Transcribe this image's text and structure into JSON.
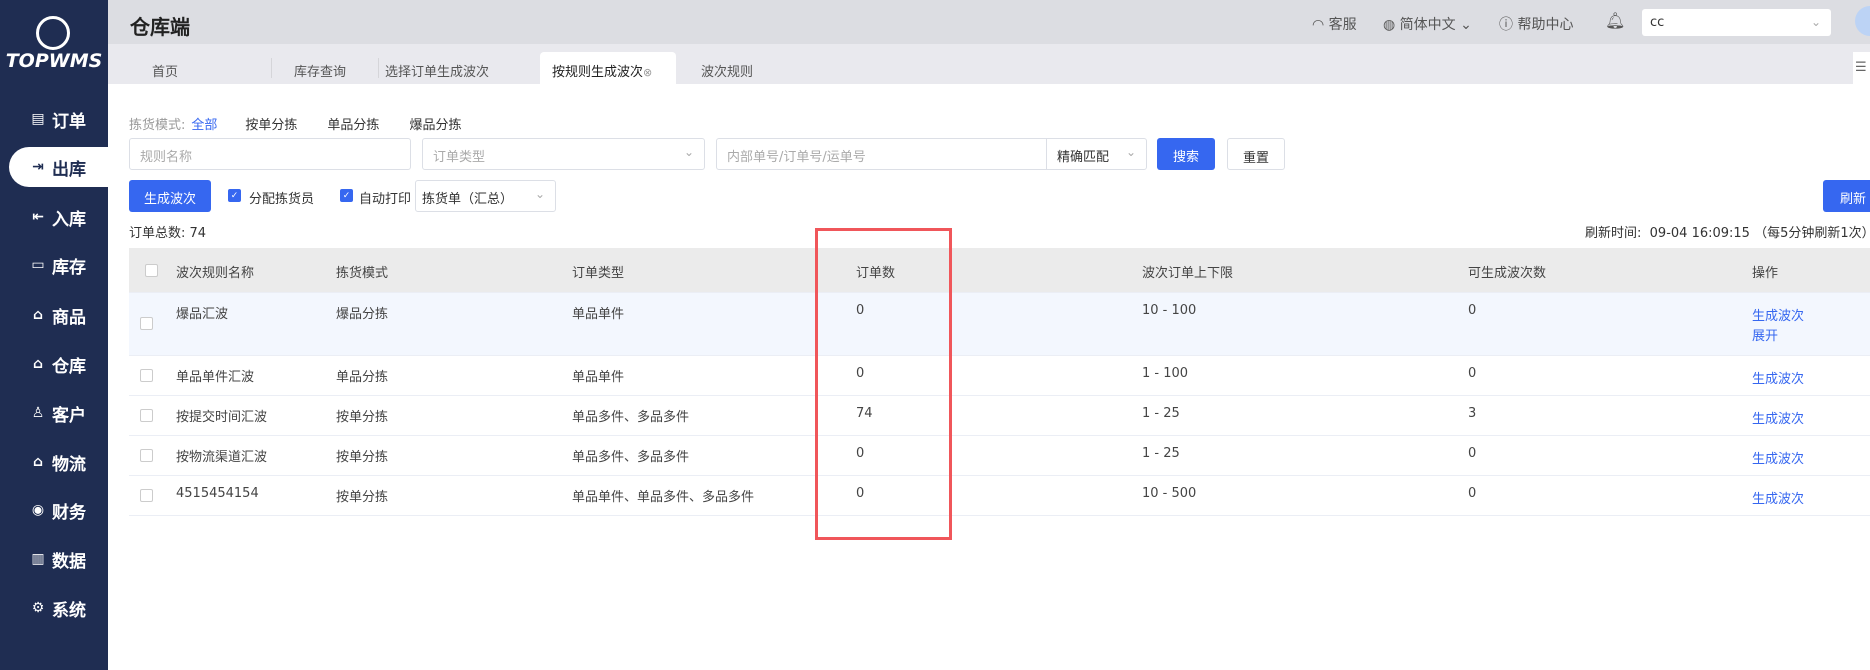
{
  "brand": {
    "name": "TOPWMS"
  },
  "sidebar": {
    "items": [
      {
        "label": "订单",
        "icon": "order-icon",
        "glyph": "▤"
      },
      {
        "label": "出库",
        "icon": "outbound-icon",
        "glyph": "⇥",
        "active": true
      },
      {
        "label": "入库",
        "icon": "inbound-icon",
        "glyph": "⇤"
      },
      {
        "label": "库存",
        "icon": "inventory-icon",
        "glyph": "▭"
      },
      {
        "label": "商品",
        "icon": "goods-icon",
        "glyph": "⌂"
      },
      {
        "label": "仓库",
        "icon": "warehouse-icon",
        "glyph": "⌂"
      },
      {
        "label": "客户",
        "icon": "customer-icon",
        "glyph": "♙"
      },
      {
        "label": "物流",
        "icon": "logistics-icon",
        "glyph": "⌂"
      },
      {
        "label": "财务",
        "icon": "finance-icon",
        "glyph": "◉"
      },
      {
        "label": "数据",
        "icon": "data-icon",
        "glyph": "▥"
      },
      {
        "label": "系统",
        "icon": "settings-icon",
        "glyph": "⚙"
      }
    ]
  },
  "header": {
    "title": "仓库端",
    "service": "客服",
    "language": "简体中文",
    "help": "帮助中心",
    "user_select": "cc"
  },
  "tabs": [
    {
      "label": "首页"
    },
    {
      "label": "库存查询"
    },
    {
      "label": "选择订单生成波次"
    },
    {
      "label": "按规则生成波次",
      "active": true
    },
    {
      "label": "波次规则"
    }
  ],
  "filters": {
    "pick_mode_label": "拣货模式:",
    "pick_modes": [
      "全部",
      "按单分拣",
      "单品分拣",
      "爆品分拣"
    ],
    "rule_name_placeholder": "规则名称",
    "order_type_placeholder": "订单类型",
    "order_no_placeholder": "内部单号/订单号/运单号",
    "match_mode": "精确匹配",
    "search": "搜索",
    "reset": "重置"
  },
  "actions": {
    "generate": "生成波次",
    "assign_picker": "分配拣货员",
    "auto_print": "自动打印",
    "print_type": "拣货单（汇总）",
    "refresh": "刷新"
  },
  "summary": {
    "total_label": "订单总数:",
    "total": "74",
    "refresh_label": "刷新时间:",
    "refresh_time": "09-04 16:09:15",
    "refresh_note": "（每5分钟刷新1次）"
  },
  "table": {
    "columns": [
      "波次规则名称",
      "拣货模式",
      "订单类型",
      "订单数",
      "波次订单上下限",
      "可生成波次数",
      "操作"
    ],
    "rows": [
      {
        "name": "爆品汇波",
        "mode": "爆品分拣",
        "type": "单品单件",
        "count": "0",
        "limit": "10 - 100",
        "possible": "0",
        "ops": [
          "生成波次",
          "展开"
        ]
      },
      {
        "name": "单品单件汇波",
        "mode": "单品分拣",
        "type": "单品单件",
        "count": "0",
        "limit": "1 - 100",
        "possible": "0",
        "ops": [
          "生成波次"
        ]
      },
      {
        "name": "按提交时间汇波",
        "mode": "按单分拣",
        "type": "单品多件、多品多件",
        "count": "74",
        "limit": "1 - 25",
        "possible": "3",
        "ops": [
          "生成波次"
        ]
      },
      {
        "name": "按物流渠道汇波",
        "mode": "按单分拣",
        "type": "单品多件、多品多件",
        "count": "0",
        "limit": "1 - 25",
        "possible": "0",
        "ops": [
          "生成波次"
        ]
      },
      {
        "name": "4515454154",
        "mode": "按单分拣",
        "type": "单品单件、单品多件、多品多件",
        "count": "0",
        "limit": "10 - 500",
        "possible": "0",
        "ops": [
          "生成波次"
        ]
      }
    ]
  },
  "colors": {
    "primary": "#3667f0",
    "sidebar": "#1f2d52",
    "highlight": "#f0565a"
  }
}
